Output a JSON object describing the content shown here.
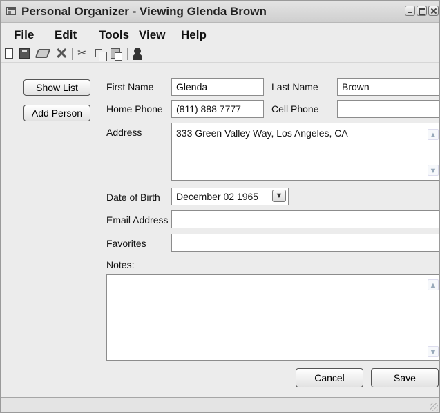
{
  "window": {
    "title": "Personal Organizer - Viewing Glenda Brown"
  },
  "menu": {
    "items": [
      "File",
      "Edit",
      "Tools",
      "View",
      "Help"
    ]
  },
  "toolbar": {
    "icons": [
      "new-document-icon",
      "save-icon",
      "print-icon",
      "delete-icon",
      "cut-icon",
      "copy-icon",
      "paste-icon",
      "person-icon"
    ],
    "delete_glyph": "✕",
    "cut_glyph": "✂"
  },
  "sidebar": {
    "show_list": "Show List",
    "add_person": "Add Person"
  },
  "form": {
    "first_name_label": "First Name",
    "first_name_value": "Glenda",
    "last_name_label": "Last Name",
    "last_name_value": "Brown",
    "home_phone_label": "Home Phone",
    "home_phone_value": "(811) 888 7777",
    "cell_phone_label": "Cell Phone",
    "cell_phone_value": "",
    "address_label": "Address",
    "address_value": "333 Green Valley Way, Los Angeles, CA",
    "dob_label": "Date of Birth",
    "dob_value": "December 02 1965",
    "email_label": "Email Address",
    "email_value": "",
    "favorites_label": "Favorites",
    "favorites_value": "",
    "notes_label": "Notes:",
    "notes_value": ""
  },
  "actions": {
    "cancel": "Cancel",
    "save": "Save"
  },
  "scroll": {
    "up": "▲",
    "down": "▼"
  },
  "status": {
    "text": ""
  }
}
